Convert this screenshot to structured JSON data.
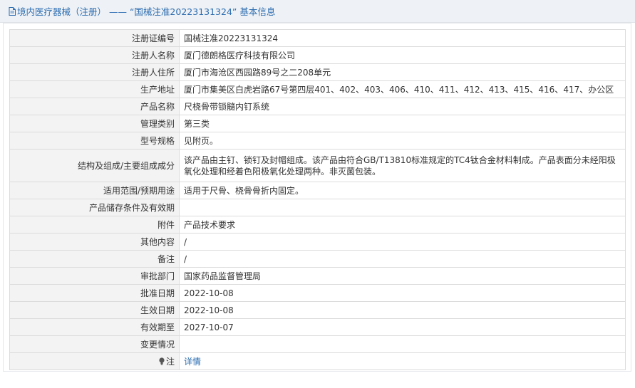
{
  "header": {
    "title": "境内医疗器械（注册） —— “国械注准20223131324” 基本信息",
    "icon": "document-icon"
  },
  "rows": [
    {
      "label": "注册证编号",
      "value": "国械注准20223131324"
    },
    {
      "label": "注册人名称",
      "value": "厦门德朗格医疗科技有限公司"
    },
    {
      "label": "注册人住所",
      "value": "厦门市海沧区西园路89号之二208单元"
    },
    {
      "label": "生产地址",
      "value": "厦门市集美区白虎岩路67号第四层401、402、403、406、410、411、412、413、415、416、417、办公区"
    },
    {
      "label": "产品名称",
      "value": "尺桡骨带锁髓内钉系统"
    },
    {
      "label": "管理类别",
      "value": "第三类"
    },
    {
      "label": "型号规格",
      "value": "见附页。"
    },
    {
      "label": "结构及组成/主要组成成分",
      "value": "该产品由主钉、锁钉及封帽组成。该产品由符合GB/T13810标准规定的TC4钛合金材料制成。产品表面分未经阳极氧化处理和经着色阳极氧化处理两种。非灭菌包装。"
    },
    {
      "label": "适用范围/预期用途",
      "value": "适用于尺骨、桡骨骨折内固定。"
    },
    {
      "label": "产品储存条件及有效期",
      "value": ""
    },
    {
      "label": "附件",
      "value": "产品技术要求"
    },
    {
      "label": "其他内容",
      "value": "/"
    },
    {
      "label": "备注",
      "value": "/"
    },
    {
      "label": "审批部门",
      "value": "国家药品监督管理局"
    },
    {
      "label": "批准日期",
      "value": "2022-10-08"
    },
    {
      "label": "生效日期",
      "value": "2022-10-08"
    },
    {
      "label": "有效期至",
      "value": "2027-10-07"
    },
    {
      "label": "变更情况",
      "value": ""
    }
  ],
  "note_row": {
    "label": "注",
    "link_text": "详情",
    "icon": "bulb-icon"
  },
  "colors": {
    "link": "#2b6cb0",
    "label_bg": "#f3f3f3",
    "border": "#dcdcdc",
    "header_bg": "#eef1f5"
  }
}
